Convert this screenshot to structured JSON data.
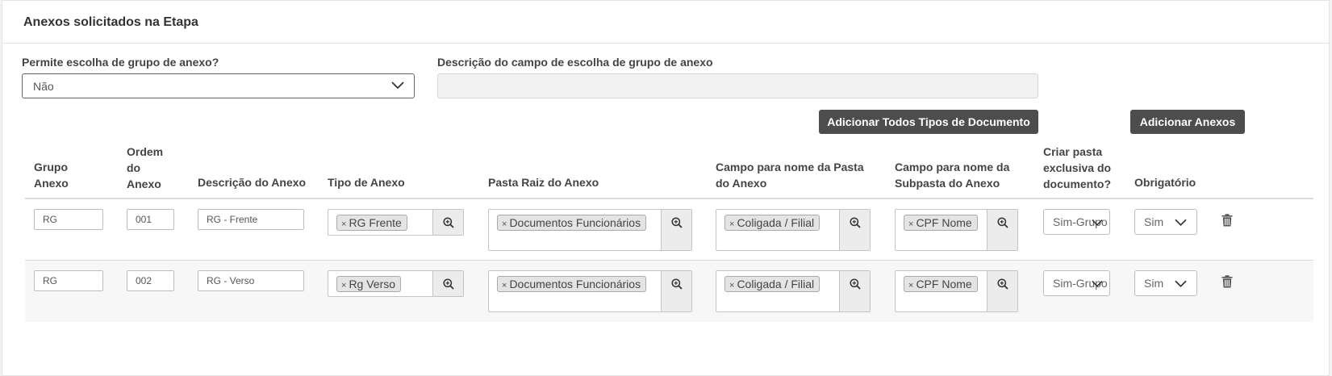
{
  "panel": {
    "title": "Anexos solicitados na Etapa"
  },
  "group_choice": {
    "label": "Permite escolha de grupo de anexo?",
    "value": "Não"
  },
  "group_desc": {
    "label": "Descrição do campo de escolha de grupo de anexo",
    "value": ""
  },
  "buttons": {
    "add_all_types": "Adicionar Todos Tipos de Documento",
    "add_attachments": "Adicionar Anexos"
  },
  "table": {
    "headers": {
      "grupo": [
        "Grupo",
        "Anexo"
      ],
      "ordem": [
        "Ordem",
        "do",
        "Anexo"
      ],
      "descricao": "Descrição do Anexo",
      "tipo": "Tipo de Anexo",
      "pasta_raiz": "Pasta Raiz do Anexo",
      "campo_pasta": [
        "Campo para nome da Pasta",
        "do Anexo"
      ],
      "campo_subpasta": [
        "Campo para nome da",
        "Subpasta do Anexo"
      ],
      "criar_pasta": [
        "Criar pasta",
        "exclusiva do",
        "documento?"
      ],
      "obrigatorio": "Obrigatório"
    },
    "remove_symbol": "×",
    "rows": [
      {
        "grupo": "RG",
        "ordem": "001",
        "descricao": "RG - Frente",
        "tipo": "RG Frente",
        "pasta_raiz": "Documentos Funcionários",
        "campo_pasta": "Coligada / Filial",
        "campo_subpasta": "CPF Nome",
        "criar_pasta": "Sim-Grupo",
        "obrigatorio": "Sim"
      },
      {
        "grupo": "RG",
        "ordem": "002",
        "descricao": "RG - Verso",
        "tipo": "Rg Verso",
        "pasta_raiz": "Documentos Funcionários",
        "campo_pasta": "Coligada / Filial",
        "campo_subpasta": "CPF Nome",
        "criar_pasta": "Sim-Grupo",
        "obrigatorio": "Sim"
      }
    ]
  },
  "colors": {
    "button_bg": "#4d4d4d",
    "row_alt_bg": "#f7f7f7",
    "tag_bg": "#e4e4e4"
  },
  "icons": {
    "dropdown": "chevron-down-icon",
    "lookup": "magnifier-plus-icon",
    "delete": "trash-icon"
  }
}
